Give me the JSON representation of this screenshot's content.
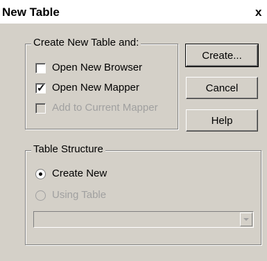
{
  "window": {
    "title": "New Table",
    "close_label": "x"
  },
  "create_group": {
    "legend": "Create New Table and:",
    "options": [
      {
        "label": "Open New Browser",
        "checked": false,
        "enabled": true
      },
      {
        "label": "Open New Mapper",
        "checked": true,
        "enabled": true
      },
      {
        "label": "Add to Current Mapper",
        "checked": false,
        "enabled": false
      }
    ]
  },
  "buttons": {
    "create": "Create...",
    "cancel": "Cancel",
    "help": "Help"
  },
  "structure_group": {
    "legend": "Table Structure",
    "options": [
      {
        "label": "Create New",
        "selected": true,
        "enabled": true
      },
      {
        "label": "Using Table",
        "selected": false,
        "enabled": false
      }
    ],
    "table_select": {
      "value": "",
      "enabled": false
    }
  }
}
